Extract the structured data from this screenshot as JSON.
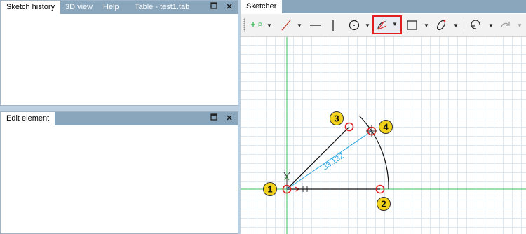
{
  "top_panel": {
    "tabs": [
      "Sketch history",
      "3D view",
      "Help",
      "Table - test1.tab"
    ],
    "restore_glyph": "▫",
    "close_glyph": "✕"
  },
  "bottom_panel": {
    "title": "Edit element",
    "close_glyph": "✕"
  },
  "sketcher": {
    "tab_label": "Sketcher",
    "toolbar": {
      "point_label": "P",
      "tools": [
        "point-icon",
        "line-icon",
        "horizontal-line-icon",
        "vertical-line-icon",
        "circle-icon",
        "arc-icon",
        "rectangle-icon",
        "ellipse-icon",
        "undo-icon",
        "redo-icon"
      ],
      "active_tool": "arc-icon",
      "active_color": "#e02020"
    },
    "drawing": {
      "dimension": "33.132",
      "markers": [
        "1",
        "2",
        "3",
        "4"
      ],
      "axis_color": "#3cbf5c",
      "dimension_color": "#2aa7e0",
      "marker_color": "#f3d21b"
    }
  }
}
